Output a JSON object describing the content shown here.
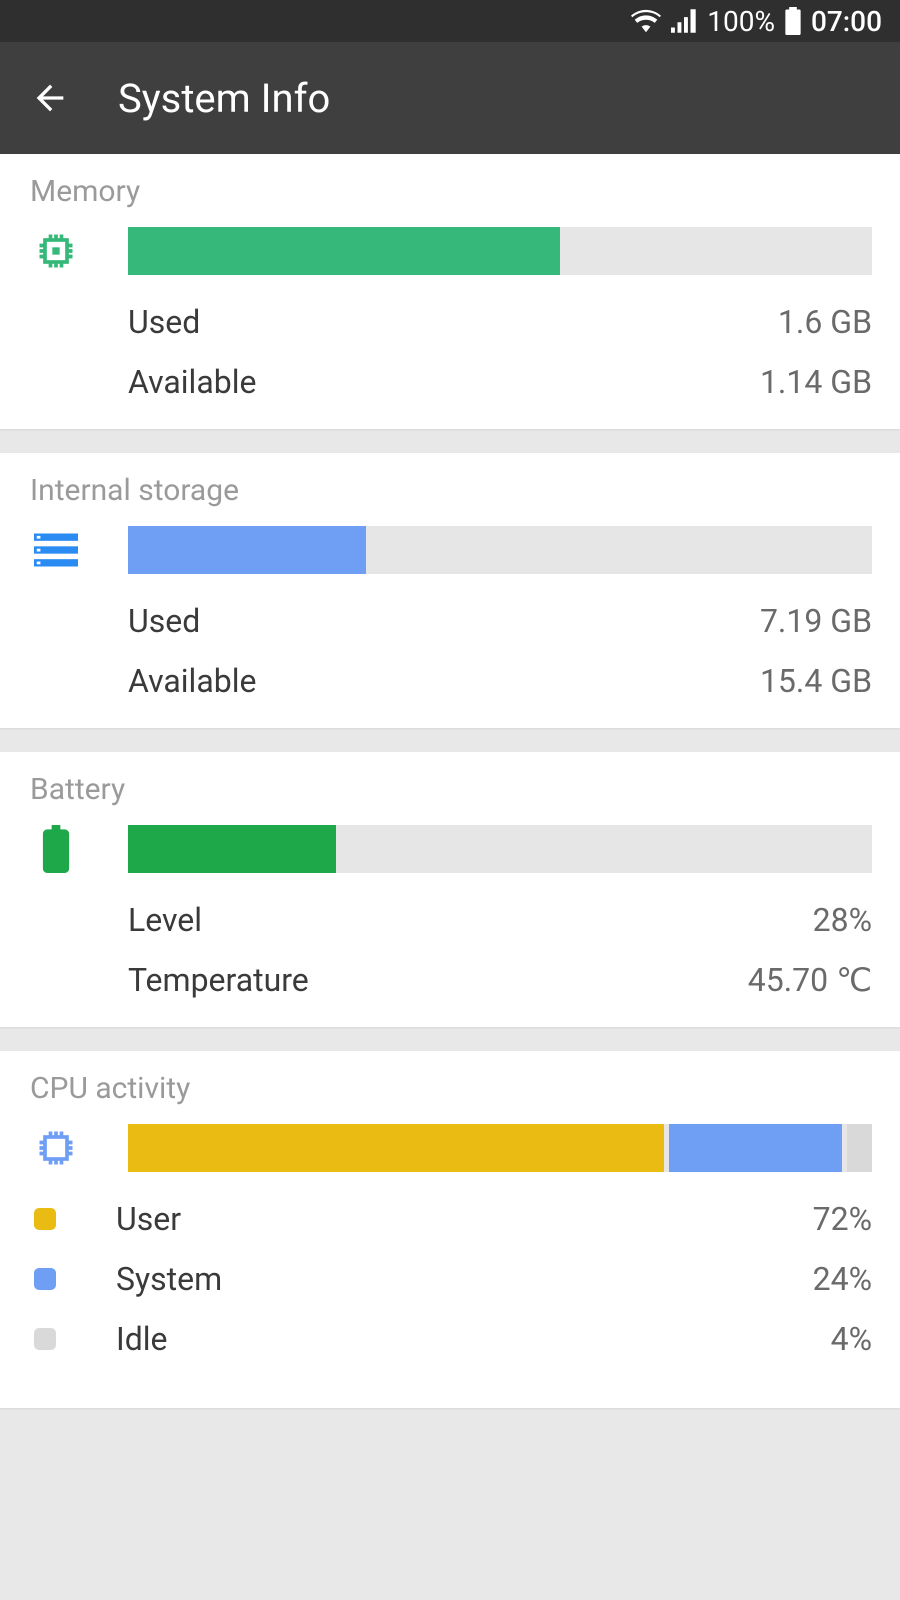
{
  "statusbar": {
    "battery_pct": "100%",
    "time": "07:00"
  },
  "appbar": {
    "title": "System Info"
  },
  "colors": {
    "mem_fill": "#35b879",
    "storage_fill": "#6f9ef5",
    "battery_fill": "#1ea84a",
    "cpu_user": "#eabb12",
    "cpu_system": "#6f9ef5",
    "cpu_idle": "#d9d9d9",
    "bar_bg": "#e6e6e6"
  },
  "memory": {
    "title": "Memory",
    "used_label": "Used",
    "used_value": "1.6 GB",
    "available_label": "Available",
    "available_value": "1.14 GB",
    "fill_pct": 58
  },
  "storage": {
    "title": "Internal storage",
    "used_label": "Used",
    "used_value": "7.19 GB",
    "available_label": "Available",
    "available_value": "15.4 GB",
    "fill_pct": 32
  },
  "battery": {
    "title": "Battery",
    "level_label": "Level",
    "level_value": "28%",
    "temp_label": "Temperature",
    "temp_value": "45.70 ℃",
    "fill_pct": 28
  },
  "cpu": {
    "title": "CPU activity",
    "items": [
      {
        "label": "User",
        "value": "72%",
        "color": "#eabb12"
      },
      {
        "label": "System",
        "value": "24%",
        "color": "#6f9ef5"
      },
      {
        "label": "Idle",
        "value": "4%",
        "color": "#d9d9d9"
      }
    ]
  }
}
